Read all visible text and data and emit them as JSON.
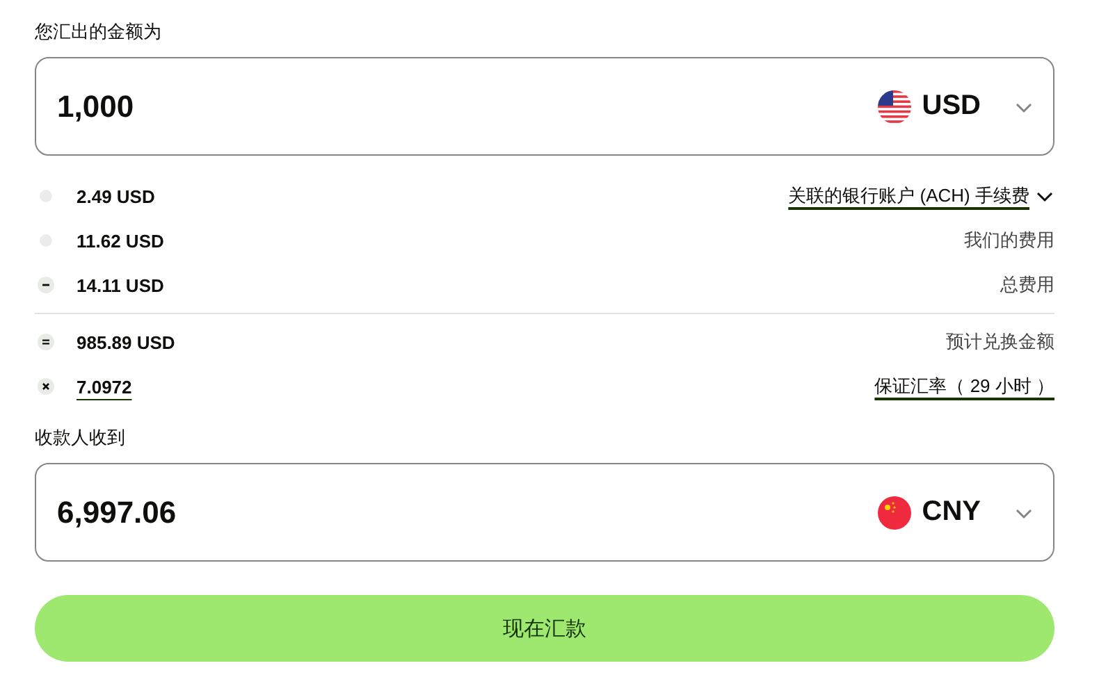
{
  "send": {
    "label": "您汇出的金额为",
    "amount": "1,000",
    "currency": "USD"
  },
  "fees": [
    {
      "kind": "dot",
      "amount": "2.49 USD",
      "label": "关联的银行账户 (ACH) 手续费",
      "underlined": true,
      "dropdown": true
    },
    {
      "kind": "dot",
      "amount": "11.62 USD",
      "label": "我们的费用",
      "underlined": false,
      "dropdown": false
    },
    {
      "kind": "minus",
      "amount": "14.11 USD",
      "label": "总费用",
      "underlined": false,
      "dropdown": false,
      "divider_after": true
    },
    {
      "kind": "equals",
      "amount": "985.89 USD",
      "label": "预计兑换金额",
      "underlined": false,
      "dropdown": false
    },
    {
      "kind": "times",
      "amount": "7.0972",
      "amount_underlined": true,
      "label": "保证汇率（ 29 小时 ）",
      "underlined": true,
      "dropdown": false
    }
  ],
  "receive": {
    "label": "收款人收到",
    "amount": "6,997.06",
    "currency": "CNY"
  },
  "button": "现在汇款"
}
